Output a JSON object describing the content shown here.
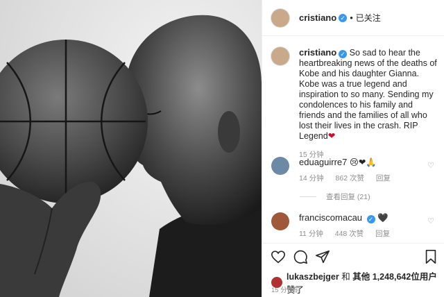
{
  "post": {
    "username": "cristiano",
    "verified_mark": "✓",
    "separator": "•",
    "follow_status": "已关注"
  },
  "caption": {
    "username": "cristiano",
    "text": "So sad to hear the heartbreaking news of the deaths of Kobe and his daughter Gianna. Kobe was a true legend and inspiration to so many. Sending my condolences to his family and friends and the families of all who lost their lives in the crash. RIP Legend",
    "heart": "❤",
    "time": "15 分钟"
  },
  "comments": [
    {
      "username": "eduaguirre7",
      "emojis": "😢❤🙏",
      "time": "14 分钟",
      "likes": "862 次赞",
      "reply": "回复",
      "view_replies": "查看回复 (21)"
    },
    {
      "username": "franciscomacau",
      "emojis": "🖤",
      "time": "11 分钟",
      "likes": "448 次赞",
      "reply": "回复"
    }
  ],
  "likes": {
    "first_user": "lukaszbejger",
    "connector": "和",
    "others_label": "其他",
    "count": "1,248,642",
    "suffix": "位用户",
    "verb": "赞了"
  },
  "bottom_time": "15 分钟前",
  "icons": {
    "like": "heart-outline-icon",
    "comment": "comment-icon",
    "share": "send-icon",
    "save": "bookmark-icon",
    "comment_like": "small-heart-icon"
  },
  "colors": {
    "verified": "#3897f0",
    "secondary_text": "#8e8e8e",
    "heart": "#c8102e"
  }
}
